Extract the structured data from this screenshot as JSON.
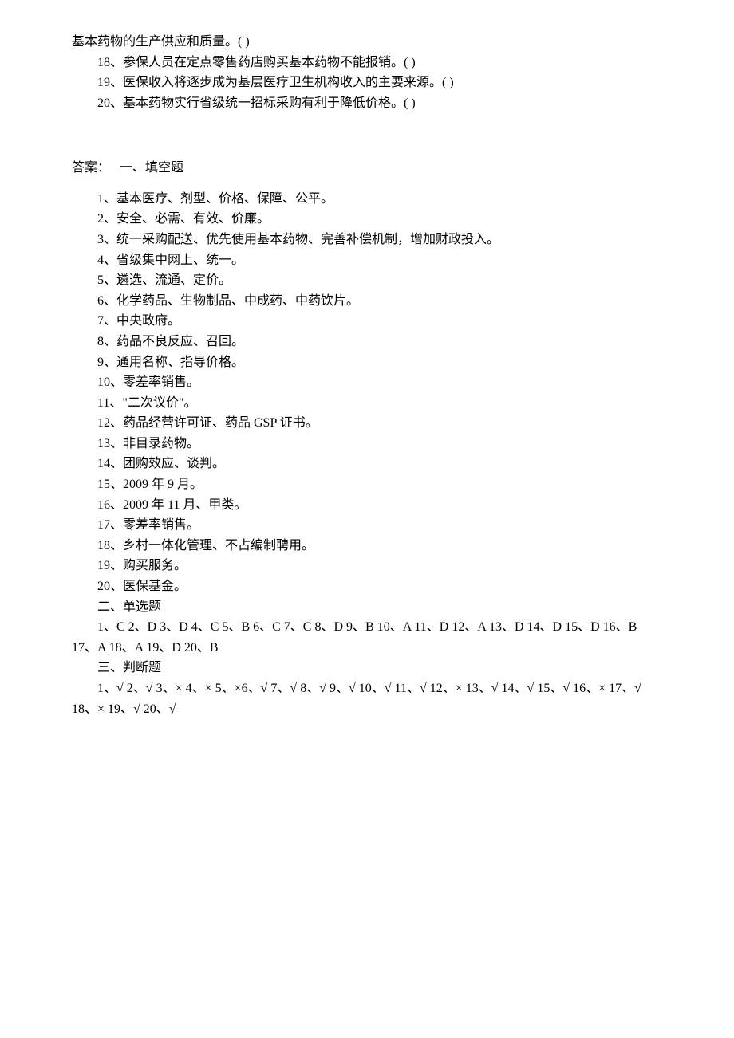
{
  "top_fragment": "基本药物的生产供应和质量。(       )",
  "questions": [
    "18、参保人员在定点零售药店购买基本药物不能报销。(       )",
    "19、医保收入将逐步成为基层医疗卫生机构收入的主要来源。(       )",
    "20、基本药物实行省级统一招标采购有利于降低价格。(       )"
  ],
  "answers_label": "答案：",
  "section1_title": "一、填空题",
  "fill_blank_answers": [
    "1、基本医疗、剂型、价格、保障、公平。",
    "2、安全、必需、有效、价廉。",
    "3、统一采购配送、优先使用基本药物、完善补偿机制，增加财政投入。",
    "4、省级集中网上、统一。",
    "5、遴选、流通、定价。",
    "6、化学药品、生物制品、中成药、中药饮片。",
    "7、中央政府。",
    "8、药品不良反应、召回。",
    "9、通用名称、指导价格。",
    "10、零差率销售。",
    "11、\"二次议价\"。",
    "12、药品经营许可证、药品 GSP 证书。",
    "13、非目录药物。",
    "14、团购效应、谈判。",
    "15、2009 年 9 月。",
    "16、2009 年 11 月、甲类。",
    "17、零差率销售。",
    "18、乡村一体化管理、不占编制聘用。",
    "19、购买服务。",
    "20、医保基金。"
  ],
  "section2_title": "二、单选题",
  "single_choice_line1": "1、C 2、D 3、D 4、C 5、B 6、C 7、C 8、D 9、B 10、A 11、D 12、A 13、D 14、D 15、D 16、B",
  "single_choice_line2": "17、A 18、A 19、D 20、B",
  "section3_title": "三、判断题",
  "judge_line1": "1、√ 2、√ 3、× 4、× 5、×6、√ 7、√ 8、√ 9、√ 10、√ 11、√ 12、× 13、√ 14、√ 15、√ 16、× 17、√",
  "judge_line2": "18、× 19、√ 20、√"
}
